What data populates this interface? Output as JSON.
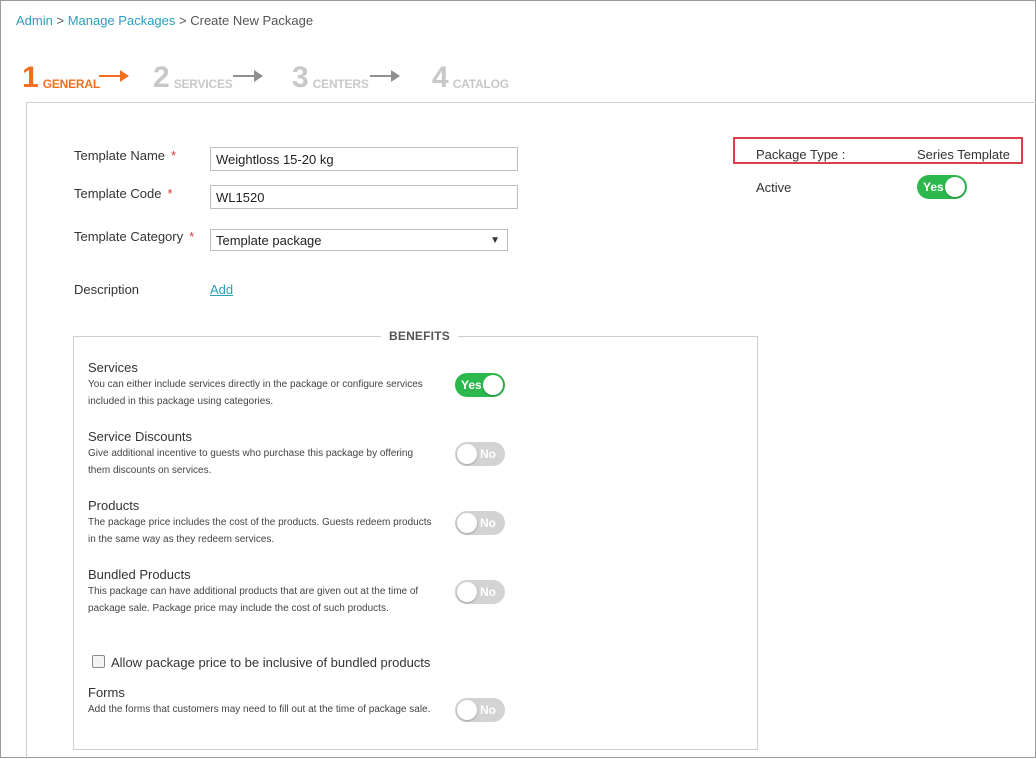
{
  "breadcrumb": {
    "items": [
      "Admin",
      "Manage Packages",
      "Create New Package"
    ],
    "separator": ">"
  },
  "steps": [
    {
      "number": "1",
      "label": "GENERAL",
      "active": true
    },
    {
      "number": "2",
      "label": "SERVICES",
      "active": false
    },
    {
      "number": "3",
      "label": "CENTERS",
      "active": false
    },
    {
      "number": "4",
      "label": "CATALOG",
      "active": false
    }
  ],
  "form": {
    "required_mark": "*",
    "template_name": {
      "label": "Template Name",
      "value": "Weightloss 15-20 kg"
    },
    "template_code": {
      "label": "Template Code",
      "value": "WL1520"
    },
    "template_category": {
      "label": "Template Category",
      "value": "Template package"
    },
    "description": {
      "label": "Description",
      "link": "Add"
    }
  },
  "side": {
    "package_type_label": "Package Type :",
    "package_type_value": "Series Template",
    "active_label": "Active",
    "active_toggle": "Yes"
  },
  "benefits": {
    "title": "BENEFITS",
    "items": [
      {
        "title": "Services",
        "desc": "You can either include services directly in the package or configure services included in this package using categories.",
        "toggle": "Yes"
      },
      {
        "title": "Service Discounts",
        "desc": "Give additional incentive to guests who purchase this package by offering them discounts on services.",
        "toggle": "No"
      },
      {
        "title": "Products",
        "desc": "The package price includes the cost of the products. Guests redeem products in the same way as they redeem services.",
        "toggle": "No"
      },
      {
        "title": "Bundled Products",
        "desc": "This package can have additional products that are given out at the time of package sale. Package price may include the cost of such products.",
        "toggle": "No"
      }
    ],
    "checkbox_label": "Allow package price to be inclusive of bundled products",
    "forms": {
      "title": "Forms",
      "desc": "Add the forms that customers may need to fill out at the time of package sale.",
      "toggle": "No"
    }
  },
  "colors": {
    "link": "#2a9fbd",
    "step_active": "#f26f21",
    "step_inactive": "#c8c8c8",
    "toggle_on": "#2db84d",
    "toggle_off": "#d3d3d3",
    "required": "#e03030",
    "highlight_border": "#d9404b"
  },
  "icons": {
    "step_arrow": "arrow-right-icon",
    "select_caret": "caret-down-icon"
  }
}
